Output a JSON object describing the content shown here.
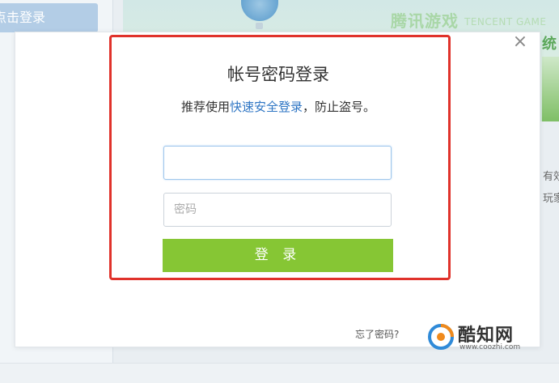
{
  "background": {
    "click_login_text": "点击登录",
    "brand_cn": "腾讯游戏",
    "brand_en": "TENCENT GAME",
    "side_heading": "统",
    "right_text_1": "有效",
    "right_text_2": "玩家"
  },
  "modal": {
    "close_glyph": "×",
    "title": "帐号密码登录",
    "recommend_prefix": "推荐使用",
    "recommend_link": "快速安全登录",
    "recommend_suffix": "，防止盗号。",
    "account_value": "",
    "account_placeholder": "",
    "password_placeholder": "密码",
    "login_button": "登 录",
    "forgot_password": "忘了密码?"
  },
  "watermark": {
    "name": "酷知网",
    "url": "www.coozhi.com"
  },
  "colors": {
    "highlight": "#e0322b",
    "login_button": "#86c634",
    "link": "#2f76c4"
  },
  "icons": {
    "close": "close-icon",
    "watermark_logo": "coozhi-logo-icon"
  }
}
